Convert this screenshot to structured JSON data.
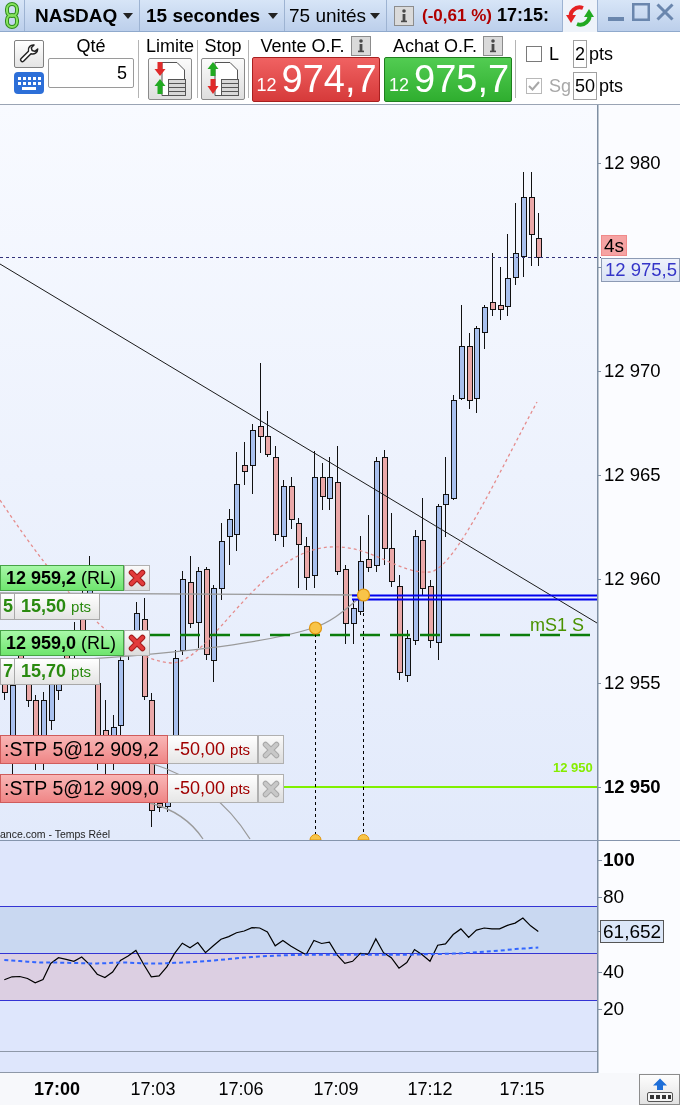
{
  "toolbar": {
    "dropdowns": [
      {
        "label": "NASDAQ",
        "bold": true
      },
      {
        "label": "15 secondes",
        "bold": true
      },
      {
        "label": "75 unités",
        "bold": false
      }
    ],
    "change": "(-0,61 %)",
    "time": "17:15:"
  },
  "order_panel": {
    "quantity_label": "Qté",
    "quantity": "5",
    "limit_label": "Limite",
    "stop_label": "Stop",
    "quotes": [
      {
        "kind": "sell",
        "label": "Vente O.F.",
        "prefix": "12",
        "price": "974,7"
      },
      {
        "kind": "buy",
        "label": "Achat O.F.",
        "prefix": "12",
        "price": "975,7"
      }
    ],
    "options": [
      {
        "label": "L",
        "checked": false,
        "disabled": false,
        "value": "2",
        "unit": "pts"
      },
      {
        "label": "Sg",
        "checked": true,
        "disabled": true,
        "value": "50",
        "unit": "pts"
      }
    ]
  },
  "price_chart": {
    "axis_labels": [
      {
        "label": "12 980",
        "major": false
      },
      {
        "label": "12 970",
        "major": false
      },
      {
        "label": "12 965",
        "major": false
      },
      {
        "label": "12 960",
        "major": false
      },
      {
        "label": "12 955",
        "major": false
      },
      {
        "label": "12 950",
        "major": true
      }
    ],
    "countdown": "4s",
    "last_price": "12 975,5",
    "levels": [
      {
        "kind": "dashed",
        "label": "mS1 S"
      },
      {
        "kind": "solid",
        "label": "12 950"
      }
    ],
    "orders": [
      {
        "kind": "limit",
        "number": "5",
        "price": "12 959,2",
        "tag": "(RL)",
        "points": "15,50",
        "unit": "pts",
        "disabled": false
      },
      {
        "kind": "limit",
        "number": "7",
        "price": "12 959,0",
        "tag": "(RL)",
        "points": "15,70",
        "unit": "pts",
        "disabled": false
      },
      {
        "kind": "stop",
        "text": ":STP 5@12 909,2",
        "points": "-50,00",
        "unit": "pts",
        "disabled": true
      },
      {
        "kind": "stop",
        "text": ":STP 5@12 909,0",
        "points": "-50,00",
        "unit": "pts",
        "disabled": true
      }
    ],
    "source": "ance.com - Temps Réel"
  },
  "indicator": {
    "value": "61,652",
    "axis_labels": [
      {
        "label": "100",
        "major": true
      },
      {
        "label": "80",
        "major": false
      },
      {
        "label": "40",
        "major": false
      },
      {
        "label": "20",
        "major": false
      }
    ],
    "chart_data": {
      "type": "line",
      "ylim": [
        -14,
        110
      ],
      "yticks": [
        100,
        80,
        40,
        20
      ],
      "series": [
        {
          "color": "#000000",
          "line_style": "solid",
          "values": [
            35.8,
            37.4,
            37.6,
            36.5,
            34.2,
            36.0,
            44.6,
            47.6,
            46.7,
            45.7,
            48.0,
            44.1,
            38.8,
            37.0,
            40.0,
            46.2,
            48.5,
            51.5,
            44.1,
            37.4,
            37.9,
            42.7,
            49.9,
            55.4,
            52.9,
            55.7,
            50.3,
            54.0,
            57.5,
            58.9,
            61.0,
            61.9,
            63.7,
            63.5,
            61.4,
            54.0,
            56.8,
            53.8,
            51.5,
            49.2,
            56.8,
            55.2,
            55.9,
            49.2,
            44.6,
            45.7,
            49.9,
            49.4,
            57.7,
            50.3,
            47.6,
            42.0,
            45.0,
            52.0,
            49.2,
            45.7,
            54.3,
            55.0,
            60.0,
            63.0,
            58.4,
            62.4,
            63.5,
            63.0,
            63.0,
            64.9,
            66.1,
            68.8,
            64.7,
            61.7
          ]
        },
        {
          "color": "#3366ff",
          "line_style": "dashed",
          "values": [
            46.4,
            46.1,
            45.8,
            45.5,
            45.2,
            45.0,
            45.0,
            45.0,
            44.9,
            44.8,
            44.7,
            44.6,
            44.6,
            44.7,
            44.9,
            45.0,
            45.0,
            44.8,
            44.6,
            44.5,
            44.5,
            44.7,
            44.9,
            45.0,
            45.2,
            45.5,
            45.8,
            46.1,
            46.5,
            46.9,
            47.3,
            47.7,
            48.0,
            48.3,
            48.5,
            48.7,
            48.9,
            49.0,
            49.1,
            49.2,
            49.2,
            49.2,
            49.2,
            49.2,
            49.2,
            49.2,
            49.2,
            49.2,
            49.2,
            49.2,
            49.2,
            49.2,
            49.2,
            49.3,
            49.4,
            49.5,
            49.6,
            49.7,
            49.8,
            50.0,
            50.2,
            50.5,
            50.8,
            51.1,
            51.4,
            51.8,
            52.2,
            52.5,
            52.8,
            53.1
          ]
        }
      ],
      "ref_lines": [
        {
          "axis": "y",
          "value": 75,
          "color": "#3434d4"
        },
        {
          "axis": "y",
          "value": 50,
          "color": "#3434d4"
        },
        {
          "axis": "y",
          "value": 25,
          "color": "#3434d4"
        },
        {
          "axis": "y",
          "value": -2,
          "color": "#8e98a8"
        }
      ],
      "bands": [
        {
          "axis": "y",
          "from": 50,
          "to": 75,
          "color": "#c9d8f1"
        },
        {
          "axis": "y",
          "from": 25,
          "to": 50,
          "color": "#dccfe2"
        }
      ]
    }
  },
  "time_axis": [
    {
      "label": "17:00",
      "major": true
    },
    {
      "label": "17:03",
      "major": false
    },
    {
      "label": "17:06",
      "major": false
    },
    {
      "label": "17:09",
      "major": false
    },
    {
      "label": "17:12",
      "major": false
    },
    {
      "label": "17:15",
      "major": false
    }
  ]
}
